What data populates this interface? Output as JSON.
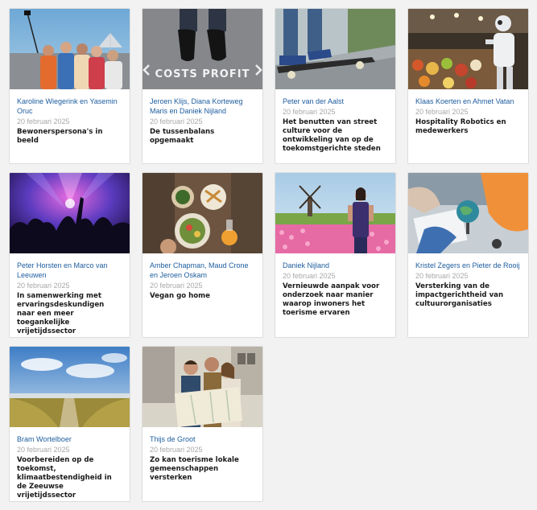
{
  "cards": [
    {
      "authors": "Karoline Wiegerink en Yasemin Oruc",
      "date": "20 februari 2025",
      "title": "Bewonerspersona's in beeld",
      "image": "group-selfie-photo",
      "image_text": ""
    },
    {
      "authors": "Jeroen Klijs, Diana Korteweg Maris en Daniek Nijland",
      "date": "20 februari 2025",
      "title": "De tussenbalans opgemaakt",
      "image": "costs-profit-photo",
      "image_text": "COSTS PROFIT"
    },
    {
      "authors": "Peter van der Aalst",
      "date": "20 februari 2025",
      "title": "Het benutten van street culture voor de ontwikkeling van op de toekomstgerichte steden",
      "image": "skateboard-photo",
      "image_text": ""
    },
    {
      "authors": "Klaas Koerten en Ahmet Vatan",
      "date": "20 februari 2025",
      "title": "Hospitality Robotics en medewerkers",
      "image": "robot-buffet-photo",
      "image_text": ""
    },
    {
      "authors": "Peter Horsten en Marco van Leeuwen",
      "date": "20 februari 2025",
      "title": "In samenwerking met ervaringsdeskundigen naar een meer toegankelijke vrijetijdssector",
      "image": "concert-crowd-photo",
      "image_text": ""
    },
    {
      "authors": "Amber Chapman, Maud Crone en Jeroen Oskam",
      "date": "20 februari 2025",
      "title": "Vegan go home",
      "image": "vegan-food-table-photo",
      "image_text": ""
    },
    {
      "authors": "Daniek Nijland",
      "date": "20 februari 2025",
      "title": "Vernieuwde aanpak voor onderzoek naar manier waarop inwoners het toerisme ervaren",
      "image": "tulip-field-windmill-photo",
      "image_text": ""
    },
    {
      "authors": "Kristel Zegers en Pieter de Rooij",
      "date": "20 februari 2025",
      "title": "Versterking van de impactgerichtheid van cultuurorganisaties",
      "image": "meeting-globe-photo",
      "image_text": ""
    },
    {
      "authors": "Bram Wortelboer",
      "date": "20 februari 2025",
      "title": "Voorbereiden op de toekomst, klimaatbestendigheid in de Zeeuwse vrijetijdssector",
      "image": "zeeland-dunes-photo",
      "image_text": ""
    },
    {
      "authors": "Thijs de Groot",
      "date": "20 februari 2025",
      "title": "Zo kan toerisme lokale gemeenschappen versterken",
      "image": "tourists-map-photo",
      "image_text": ""
    }
  ]
}
